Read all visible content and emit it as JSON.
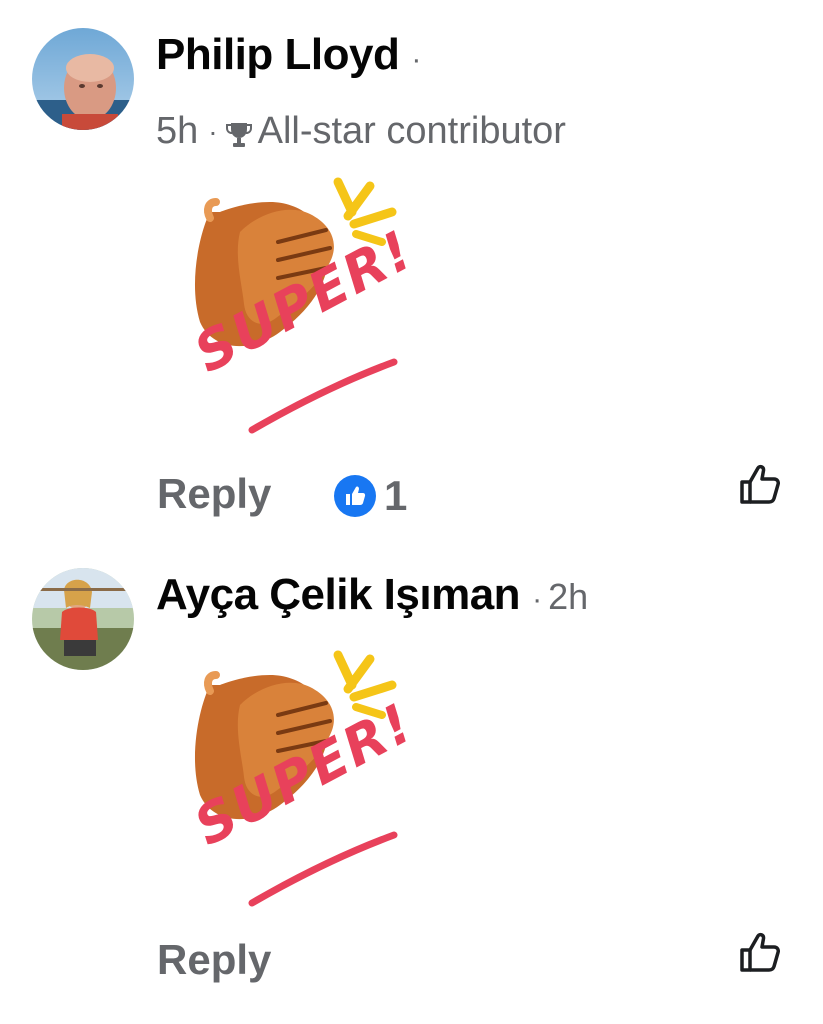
{
  "comments": [
    {
      "author": "Philip Lloyd",
      "separator": "·",
      "timestamp": "5h",
      "badge": "All-star contributor",
      "badge_icon": "trophy-icon",
      "sticker_text": "SUPER!",
      "reply_label": "Reply",
      "reaction": {
        "icon": "like-icon",
        "count": "1",
        "color": "#1877f2"
      },
      "like_icon": "thumbs-up-outline-icon"
    },
    {
      "author": "Ayça Çelik Işıman",
      "separator": "·",
      "timestamp": "2h",
      "sticker_text": "SUPER!",
      "reply_label": "Reply",
      "like_icon": "thumbs-up-outline-icon"
    }
  ],
  "colors": {
    "name": "#050505",
    "meta": "#65676b",
    "accent": "#1877f2",
    "sticker_red": "#e8415b",
    "sticker_yellow": "#f5c518",
    "hand": "#c86b2a"
  }
}
